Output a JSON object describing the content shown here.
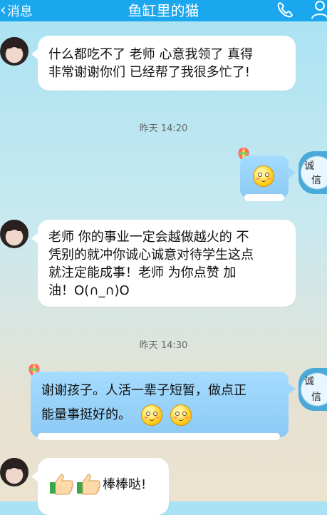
{
  "header": {
    "back_label": "消息",
    "title": "鱼缸里的猫"
  },
  "brand_badge": {
    "chars": [
      "诚",
      "信"
    ]
  },
  "messages": [
    {
      "side": "left",
      "text_lines": [
        "什么都吃不了 老师 心意我领了 真得",
        "非常谢谢你们 已经帮了我很多忙了!"
      ]
    },
    {
      "side": "right",
      "emoji": "smiley"
    },
    {
      "side": "left",
      "text_lines": [
        "老师 你的事业一定会越做越火的 不",
        "凭别的就冲你诚心诚意对待学生这点",
        "就注定能成事！老师 为你点赞 加",
        "油！O(∩_∩)O"
      ]
    },
    {
      "side": "right",
      "text_lines": [
        "谢谢孩子。人活一辈子短暂，做点正",
        "能量事挺好的。"
      ],
      "emoji": "smiley x2"
    },
    {
      "side": "left",
      "text": "棒棒哒!",
      "emoji": "thumbs-up x2"
    }
  ],
  "timestamps": [
    "昨天 14:20",
    "昨天 14:30"
  ],
  "colors": {
    "topbar": "#1aa7ee",
    "bubble_left": "#ffffff",
    "bubble_right": "#9fd6fd"
  }
}
